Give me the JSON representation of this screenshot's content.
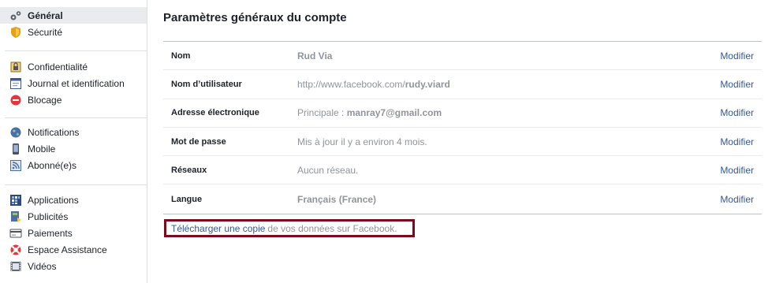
{
  "sidebar": {
    "groups": [
      [
        {
          "label": "Général",
          "icon": "gears-icon",
          "selected": true
        },
        {
          "label": "Sécurité",
          "icon": "shield-icon"
        }
      ],
      [
        {
          "label": "Confidentialité",
          "icon": "lock-icon"
        },
        {
          "label": "Journal et identification",
          "icon": "timeline-icon"
        },
        {
          "label": "Blocage",
          "icon": "block-icon"
        }
      ],
      [
        {
          "label": "Notifications",
          "icon": "globe-icon"
        },
        {
          "label": "Mobile",
          "icon": "mobile-icon"
        },
        {
          "label": "Abonné(e)s",
          "icon": "rss-icon"
        }
      ],
      [
        {
          "label": "Applications",
          "icon": "apps-icon"
        },
        {
          "label": "Publicités",
          "icon": "ads-icon"
        },
        {
          "label": "Paiements",
          "icon": "card-icon"
        },
        {
          "label": "Espace Assistance",
          "icon": "lifebuoy-icon"
        },
        {
          "label": "Vidéos",
          "icon": "film-icon"
        }
      ]
    ]
  },
  "main": {
    "title": "Paramètres généraux du compte",
    "edit_label": "Modifier",
    "rows": [
      {
        "label": "Nom",
        "value_plain": "",
        "value_bold": "Rud Via"
      },
      {
        "label": "Nom d’utilisateur",
        "value_plain": "http://www.facebook.com/",
        "value_bold": "rudy.viard"
      },
      {
        "label": "Adresse électronique",
        "value_plain": "Principale : ",
        "value_bold": "manray7@gmail.com"
      },
      {
        "label": "Mot de passe",
        "value_plain": "Mis à jour il y a environ 4 mois.",
        "value_bold": ""
      },
      {
        "label": "Réseaux",
        "value_plain": "Aucun réseau.",
        "value_bold": ""
      },
      {
        "label": "Langue",
        "value_plain": "",
        "value_bold": "Français (France)"
      }
    ],
    "download": {
      "link": "Télécharger une copie",
      "rest": "de vos données sur Facebook."
    }
  },
  "colors": {
    "link": "#365899",
    "muted": "#90949c",
    "highlight_border": "#7b0a1a"
  }
}
